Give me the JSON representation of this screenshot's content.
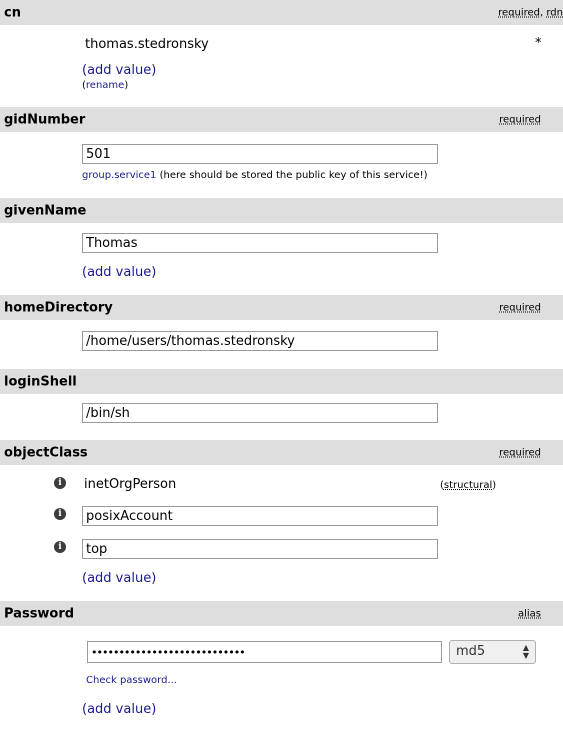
{
  "cn": {
    "name": "cn",
    "flag1": "required",
    "sep": ",",
    "flag2": "rdn",
    "value": "thomas.stedronsky",
    "marker": "*",
    "add_open": "(",
    "add_link": "add value",
    "add_close": ")",
    "rename_open": "(",
    "rename_link": "rename",
    "rename_close": ")"
  },
  "gidNumber": {
    "name": "gidNumber",
    "flag": "required",
    "value": "501",
    "group_link": "group.service1",
    "group_note": "(here should be stored the public key of this service!)"
  },
  "givenName": {
    "name": "givenName",
    "value": "Thomas",
    "add_open": "(",
    "add_link": "add value",
    "add_close": ")"
  },
  "homeDirectory": {
    "name": "homeDirectory",
    "flag": "required",
    "value": "/home/users/thomas.stedronsky"
  },
  "loginShell": {
    "name": "loginShell",
    "value": "/bin/sh"
  },
  "objectClass": {
    "name": "objectClass",
    "flag": "required",
    "info_glyph": "i",
    "values": [
      "inetOrgPerson",
      "posixAccount",
      "top"
    ],
    "structural_open": "(",
    "structural_link": "structural",
    "structural_close": ")",
    "add_open": "(",
    "add_link": "add value",
    "add_close": ")"
  },
  "password": {
    "name": "Password",
    "flag": "alias",
    "value": "••••••••••••••••••••••••••••",
    "hash": "md5",
    "check_link": "Check password...",
    "add_open": "(",
    "add_link": "add value",
    "add_close": ")"
  },
  "colors": {
    "header_bg": "#dedede",
    "link": "#1a1a8c",
    "input_border": "#9a9a9a"
  }
}
